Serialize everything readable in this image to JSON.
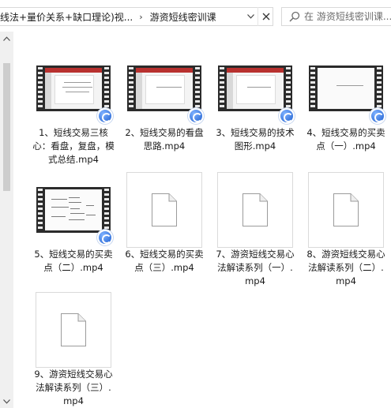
{
  "address_bar": {
    "breadcrumb_parent": "线法+量价关系+缺口理论)视...",
    "breadcrumb_separator": "›",
    "breadcrumb_current": "游资短线密训课",
    "dropdown_icon": "chevron-down-icon",
    "clear_icon": "close-icon"
  },
  "search": {
    "placeholder": "在 游资短线密训课...",
    "icon": "search-icon"
  },
  "scrollbar": {
    "up_arrow": "▲",
    "down_arrow": "▼"
  },
  "files": [
    {
      "label": "1、短线交易三核心：看盘，复盘，模式总结.mp4",
      "kind": "video",
      "badge": "baidu-player-icon"
    },
    {
      "label": "2、短线交易的看盘思路.mp4",
      "kind": "video",
      "badge": "baidu-player-icon"
    },
    {
      "label": "3、短线交易的技术图形.mp4",
      "kind": "video",
      "badge": "baidu-player-icon"
    },
    {
      "label": "4、短线交易的买卖点（一）.mp4",
      "kind": "video",
      "badge": "baidu-player-icon"
    },
    {
      "label": "5、短线交易的买卖点（二）.mp4",
      "kind": "video",
      "badge": "baidu-player-icon"
    },
    {
      "label": "6、短线交易的买卖点（三）.mp4",
      "kind": "file"
    },
    {
      "label": "7、游资短线交易心法解读系列（一）.mp4",
      "kind": "file"
    },
    {
      "label": "8、游资短线交易心法解读系列（二）.mp4",
      "kind": "file"
    },
    {
      "label": "9、游资短线交易心法解读系列（三）.mp4",
      "kind": "file"
    }
  ],
  "colors": {
    "film_frame": "#2b2b2b",
    "slide_header": "#b8312f",
    "badge_blue": "#1e5fd0",
    "border": "#d9d9d9"
  }
}
